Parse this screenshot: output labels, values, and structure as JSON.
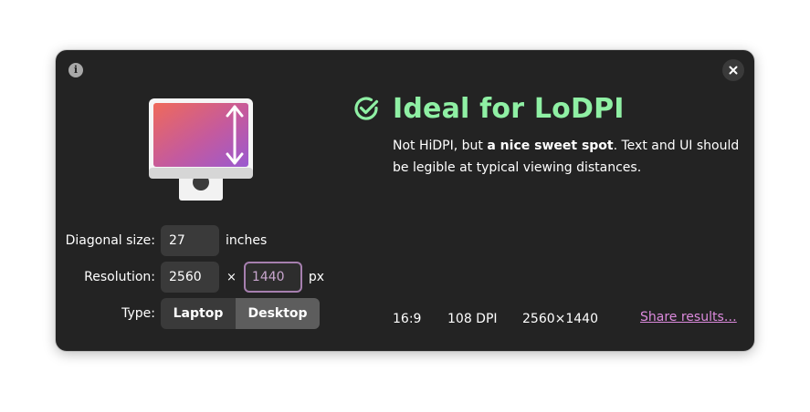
{
  "icons": {
    "info": "info-icon",
    "close": "close-icon",
    "monitor": "monitor-icon",
    "result": "check-circle-icon"
  },
  "info_button": {
    "glyph": "i"
  },
  "form": {
    "diagonal_label": "Diagonal size:",
    "diagonal_value": "27",
    "diagonal_unit": "inches",
    "resolution_label": "Resolution:",
    "width_value": "2560",
    "times_symbol": "×",
    "height_value": "1440",
    "resolution_unit": "px",
    "type_label": "Type:",
    "type_options": [
      {
        "label": "Laptop",
        "selected": false
      },
      {
        "label": "Desktop",
        "selected": true
      }
    ]
  },
  "result": {
    "title": "Ideal for LoDPI",
    "desc_prefix": "Not HiDPI, but ",
    "desc_bold": "a nice sweet spot",
    "desc_suffix": ". Text and UI should be legible at typical viewing distances."
  },
  "stats": {
    "aspect_ratio": "16:9",
    "dpi": "108 DPI",
    "resolution": "2560×1440"
  },
  "share_link": "Share results…",
  "colors": {
    "window_bg": "#232323",
    "accent_green": "#8ff0a4",
    "link_purple": "#dc8add",
    "focus_border": "#a67faf",
    "field_bg": "#3a3a3a",
    "toggle_active": "#5d5d5d"
  }
}
